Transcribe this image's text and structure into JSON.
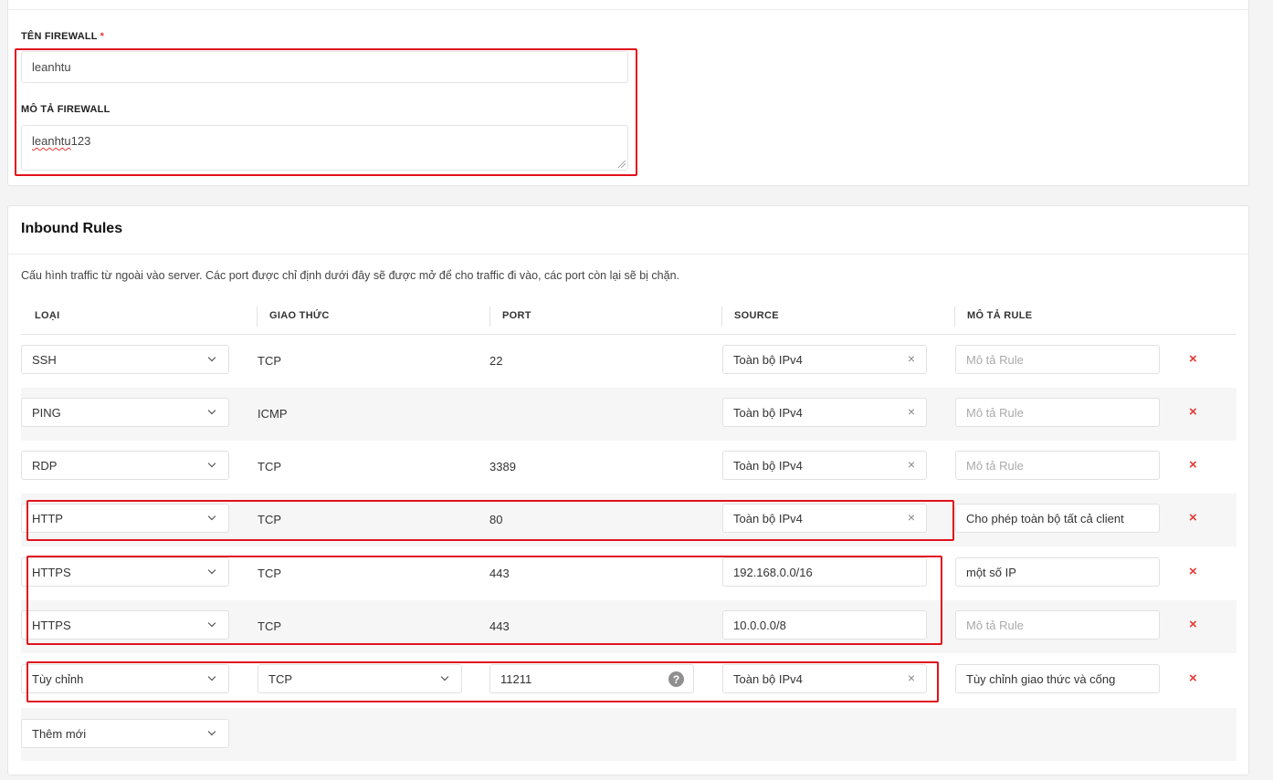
{
  "firewall": {
    "name_label": "TÊN FIREWALL",
    "required_mark": "*",
    "name_value": "leanhtu",
    "desc_label": "MÔ TẢ FIREWALL",
    "desc_value_underlined": "leanhtu",
    "desc_value_rest": "123"
  },
  "inbound": {
    "title": "Inbound Rules",
    "description": "Cấu hình traffic từ ngoài vào server. Các port được chỉ định dưới đây sẽ được mở để cho traffic đi vào, các port còn lại sẽ bị chặn.",
    "columns": [
      "LOẠI",
      "GIAO THỨC",
      "PORT",
      "SOURCE",
      "MÔ TẢ RULE"
    ],
    "rule_desc_placeholder": "Mô tả Rule",
    "clear_symbol": "×",
    "delete_symbol": "×",
    "help_symbol": "?",
    "rules": [
      {
        "type": "SSH",
        "protocol": "TCP",
        "port": "22",
        "source": "Toàn bộ IPv4",
        "desc": ""
      },
      {
        "type": "PING",
        "protocol": "ICMP",
        "port": "",
        "source": "Toàn bộ IPv4",
        "desc": ""
      },
      {
        "type": "RDP",
        "protocol": "TCP",
        "port": "3389",
        "source": "Toàn bộ IPv4",
        "desc": ""
      },
      {
        "type": "HTTP",
        "protocol": "TCP",
        "port": "80",
        "source": "Toàn bộ IPv4",
        "desc": "Cho phép toàn bộ tất cả client"
      },
      {
        "type": "HTTPS",
        "protocol": "TCP",
        "port": "443",
        "source": "192.168.0.0/16",
        "desc": "một số IP"
      },
      {
        "type": "HTTPS",
        "protocol": "TCP",
        "port": "443",
        "source": "10.0.0.0/8",
        "desc": ""
      },
      {
        "type": "Tùy chỉnh",
        "protocol": "TCP",
        "port": "11211",
        "source": "Toàn bộ IPv4",
        "desc": "Tùy chỉnh giao thức và cống"
      }
    ],
    "add_new_label": "Thêm mới"
  },
  "colors": {
    "highlight": "#e0121b",
    "danger": "#e53935"
  }
}
